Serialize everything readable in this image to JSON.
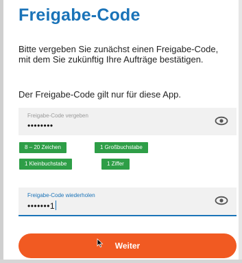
{
  "page": {
    "title": "Freigabe-Code",
    "intro": "Bitte vergeben Sie zunächst einen Freigabe-Code, mit dem Sie zukünftig Ihre Aufträge bestätigen.",
    "note": "Der Freigabe-Code gilt nur für diese App."
  },
  "code_field": {
    "label": "Freigabe-Code vergeben",
    "value": "••••••••",
    "toggle_icon": "eye-icon"
  },
  "requirements": [
    {
      "label": "8 – 20 Zeichen"
    },
    {
      "label": "1 Großbuchstabe"
    },
    {
      "label": "1 Kleinbuchstabe"
    },
    {
      "label": "1 Ziffer"
    }
  ],
  "repeat_field": {
    "label": "Freigabe-Code wiederholen",
    "value": "•••••••1",
    "toggle_icon": "eye-icon"
  },
  "actions": {
    "continue_label": "Weiter"
  },
  "colors": {
    "primary": "#1a73b8",
    "chip": "#2e9e47",
    "accent": "#f15a22"
  }
}
